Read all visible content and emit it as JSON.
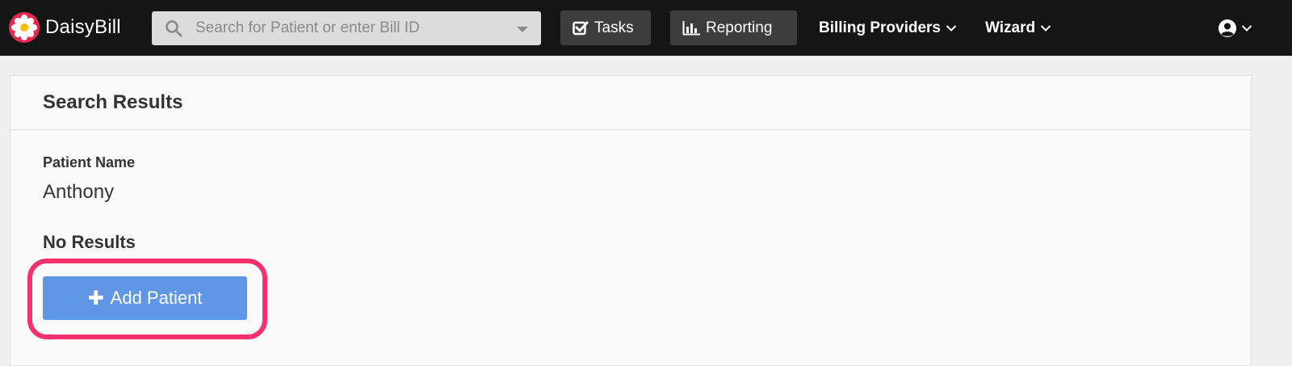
{
  "brand": {
    "name": "DaisyBill",
    "icon": "daisy-flower-logo",
    "color": "#e8264f"
  },
  "search": {
    "placeholder": "Search for Patient or enter Bill ID",
    "icon": "search-icon"
  },
  "nav": {
    "tasks_label": "Tasks",
    "reporting_label": "Reporting",
    "billing_providers_label": "Billing Providers",
    "wizard_label": "Wizard",
    "user_icon": "user-circle-icon"
  },
  "results": {
    "title": "Search Results",
    "patient_name_label": "Patient Name",
    "patient_name_value": "Anthony",
    "no_results_text": "No Results",
    "add_patient_label": "Add Patient"
  },
  "colors": {
    "navbar": "#151515",
    "primary_button": "#5f96e6",
    "highlight": "#f4306d"
  }
}
